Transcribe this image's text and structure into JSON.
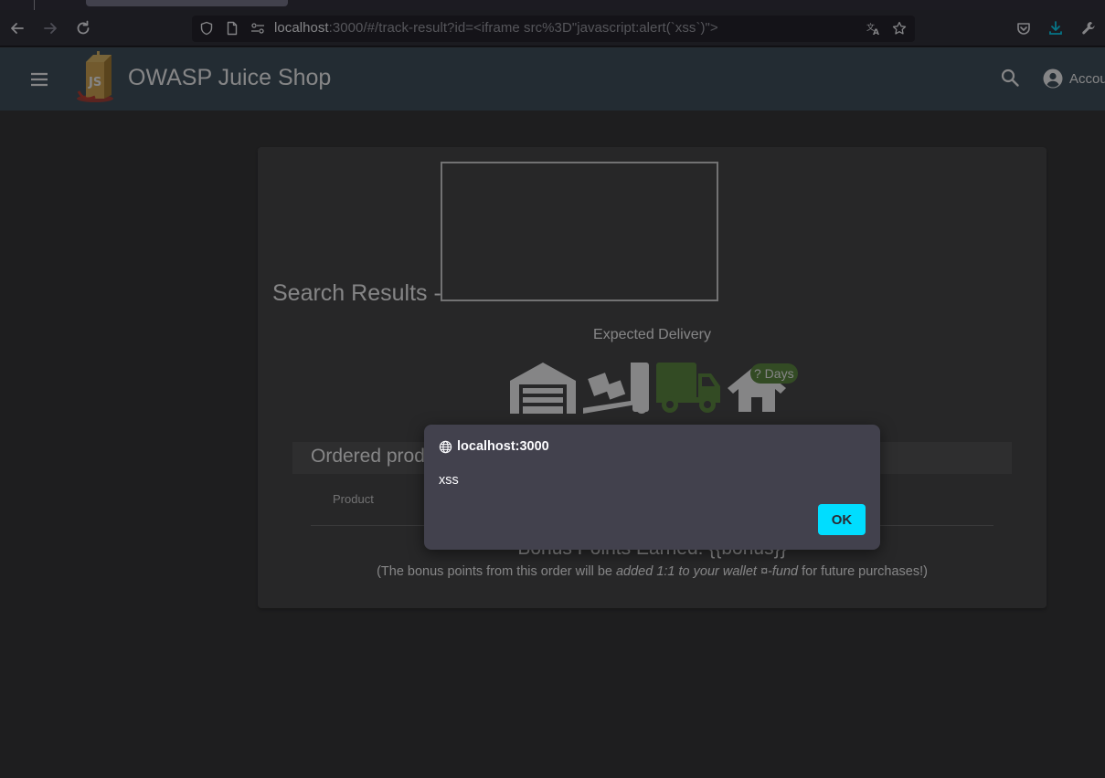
{
  "browser": {
    "url_host": "localhost",
    "url_rest": ":3000/#/track-result?id=<iframe src%3D\"javascript:alert(`xss`)\">"
  },
  "icons": {
    "back": "arrow-left-icon",
    "forward": "arrow-right-icon",
    "reload": "reload-icon",
    "tracking_protection": "shield-icon",
    "page_info": "page-icon",
    "permissions": "permissions-icon",
    "translate": "translate-icon",
    "bookmark": "star-icon",
    "pocket": "pocket-icon",
    "downloads": "download-icon",
    "devtools": "wrench-icon",
    "menu": "hamburger-icon",
    "search": "search-icon",
    "account": "account-circle-icon",
    "globe": "globe-icon",
    "warehouse": "warehouse-icon",
    "dolly": "dolly-icon",
    "truck": "truck-icon",
    "home": "home-icon"
  },
  "colors": {
    "header_bg": "#3b4d58",
    "card_bg": "#424242",
    "active_stage": "#5a8a3a",
    "inactive_stage": "#ffffff",
    "ok_button": "#00ddff"
  },
  "app": {
    "title": "OWASP Juice Shop",
    "account_label": "Account"
  },
  "track_result": {
    "heading": "Search Results -",
    "expected_delivery_label": "Expected Delivery",
    "days_badge": "? Days",
    "active_stage": "truck",
    "ordered_products_title": "Ordered products",
    "columns": [
      "Product"
    ],
    "bonus_title": "Bonus Points Earned: {{bonus}}",
    "bonus_note_prefix": "(The bonus points from this order will be ",
    "bonus_note_italic": "added 1:1 to your wallet ¤-fund",
    "bonus_note_suffix": " for future purchases!)"
  },
  "alert_dialog": {
    "origin": "localhost:3000",
    "message": "xss",
    "ok_label": "OK"
  }
}
